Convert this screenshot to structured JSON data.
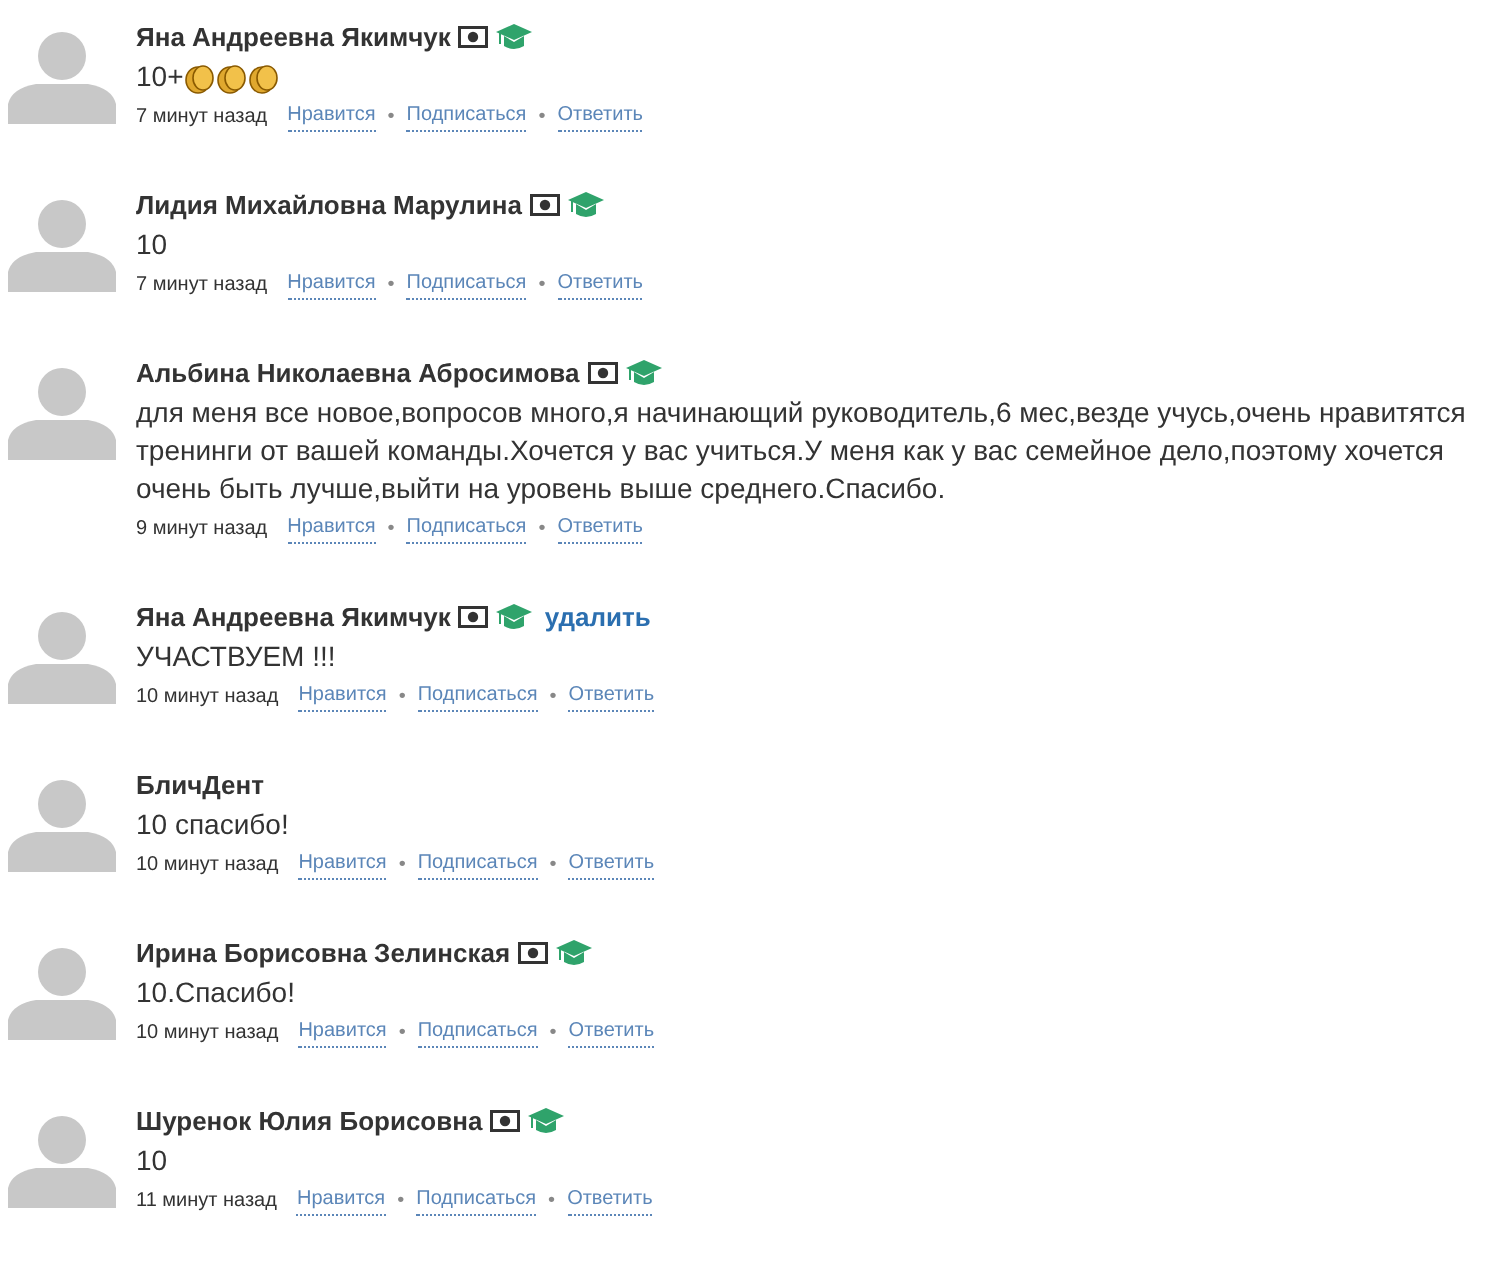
{
  "comments": [
    {
      "author": "Яна Андреевна Якимчук",
      "badges": [
        {
          "kind": "money"
        },
        {
          "kind": "graduate"
        }
      ],
      "text": "10+",
      "reactions": [
        {
          "kind": "clap"
        },
        {
          "kind": "clap"
        },
        {
          "kind": "clap"
        }
      ],
      "time": "7 минут назад",
      "actions": [
        {
          "kind": "link",
          "label": "Нравится"
        },
        {
          "kind": "sep",
          "label": "•"
        },
        {
          "kind": "link",
          "label": "Подписаться"
        },
        {
          "kind": "sep",
          "label": "•"
        },
        {
          "kind": "link",
          "label": "Ответить"
        }
      ]
    },
    {
      "author": "Лидия Михайловна Марулина",
      "badges": [
        {
          "kind": "money"
        },
        {
          "kind": "graduate"
        }
      ],
      "text": "10",
      "time": "7 минут назад",
      "actions": [
        {
          "kind": "link",
          "label": "Нравится"
        },
        {
          "kind": "sep",
          "label": "•"
        },
        {
          "kind": "link",
          "label": "Подписаться"
        },
        {
          "kind": "sep",
          "label": "•"
        },
        {
          "kind": "link",
          "label": "Ответить"
        }
      ]
    },
    {
      "author": "Альбина Николаевна Абросимова",
      "badges": [
        {
          "kind": "money"
        },
        {
          "kind": "graduate"
        }
      ],
      "text": "для меня все новое,вопросов много,я начинающий руководитель,6 мес,везде учусь,очень нравитятся тренинги от вашей команды.Хочется у вас учиться.У меня как у вас семейное дело,поэтому хочется очень быть лучше,выйти на уровень выше среднего.Спасибо.",
      "time": "9 минут назад",
      "actions": [
        {
          "kind": "link",
          "label": "Нравится"
        },
        {
          "kind": "sep",
          "label": "•"
        },
        {
          "kind": "link",
          "label": "Подписаться"
        },
        {
          "kind": "sep",
          "label": "•"
        },
        {
          "kind": "link",
          "label": "Ответить"
        }
      ]
    },
    {
      "author": "Яна Андреевна Якимчук",
      "badges": [
        {
          "kind": "money"
        },
        {
          "kind": "graduate"
        }
      ],
      "delete": "удалить",
      "text": "УЧАСТВУЕМ !!!",
      "time": "10 минут назад",
      "actions": [
        {
          "kind": "link",
          "label": "Нравится"
        },
        {
          "kind": "sep",
          "label": "•"
        },
        {
          "kind": "link",
          "label": "Подписаться"
        },
        {
          "kind": "sep",
          "label": "•"
        },
        {
          "kind": "link",
          "label": "Ответить"
        }
      ]
    },
    {
      "author": "БличДент",
      "text": "10 спасибо!",
      "time": "10 минут назад",
      "actions": [
        {
          "kind": "link",
          "label": "Нравится"
        },
        {
          "kind": "sep",
          "label": "•"
        },
        {
          "kind": "link",
          "label": "Подписаться"
        },
        {
          "kind": "sep",
          "label": "•"
        },
        {
          "kind": "link",
          "label": "Ответить"
        }
      ]
    },
    {
      "author": "Ирина Борисовна Зелинская",
      "badges": [
        {
          "kind": "money"
        },
        {
          "kind": "graduate"
        }
      ],
      "text": "10.Спасибо!",
      "time": "10 минут назад",
      "actions": [
        {
          "kind": "link",
          "label": "Нравится"
        },
        {
          "kind": "sep",
          "label": "•"
        },
        {
          "kind": "link",
          "label": "Подписаться"
        },
        {
          "kind": "sep",
          "label": "•"
        },
        {
          "kind": "link",
          "label": "Ответить"
        }
      ]
    },
    {
      "author": "Шуренок Юлия Борисовна",
      "badges": [
        {
          "kind": "money"
        },
        {
          "kind": "graduate"
        }
      ],
      "text": "10",
      "time": "11 минут назад",
      "actions": [
        {
          "kind": "link",
          "label": "Нравится"
        },
        {
          "kind": "sep",
          "label": "•"
        },
        {
          "kind": "link",
          "label": "Подписаться"
        },
        {
          "kind": "sep",
          "label": "•"
        },
        {
          "kind": "link",
          "label": "Ответить"
        }
      ]
    }
  ]
}
